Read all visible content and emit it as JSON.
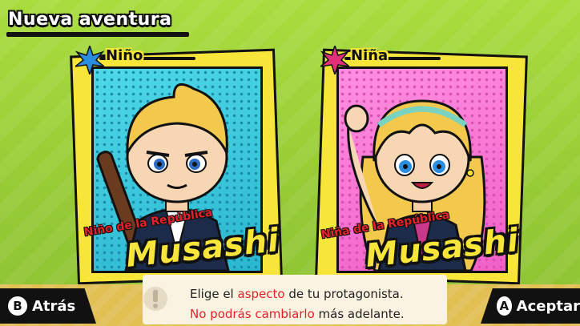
{
  "header": {
    "title": "Nueva aventura"
  },
  "cards": [
    {
      "gender": "Niño",
      "subtitle": "Niño de la República",
      "name": "Musashi",
      "accent": "#2bb6d0"
    },
    {
      "gender": "Niña",
      "subtitle": "Niña de la República",
      "name": "Musashi",
      "accent": "#f060c8"
    }
  ],
  "message": {
    "line1_pre": "Elige el ",
    "line1_hl": "aspecto",
    "line1_post": " de tu protagonista.",
    "line2_hl": "No podrás cambiarlo",
    "line2_post": " más adelante."
  },
  "buttons": {
    "back_key": "B",
    "back_label": "Atrás",
    "accept_key": "A",
    "accept_label": "Aceptar"
  },
  "colors": {
    "background": "#9fd23a",
    "card_frame": "#f7e53a",
    "highlight": "#e8202a"
  }
}
